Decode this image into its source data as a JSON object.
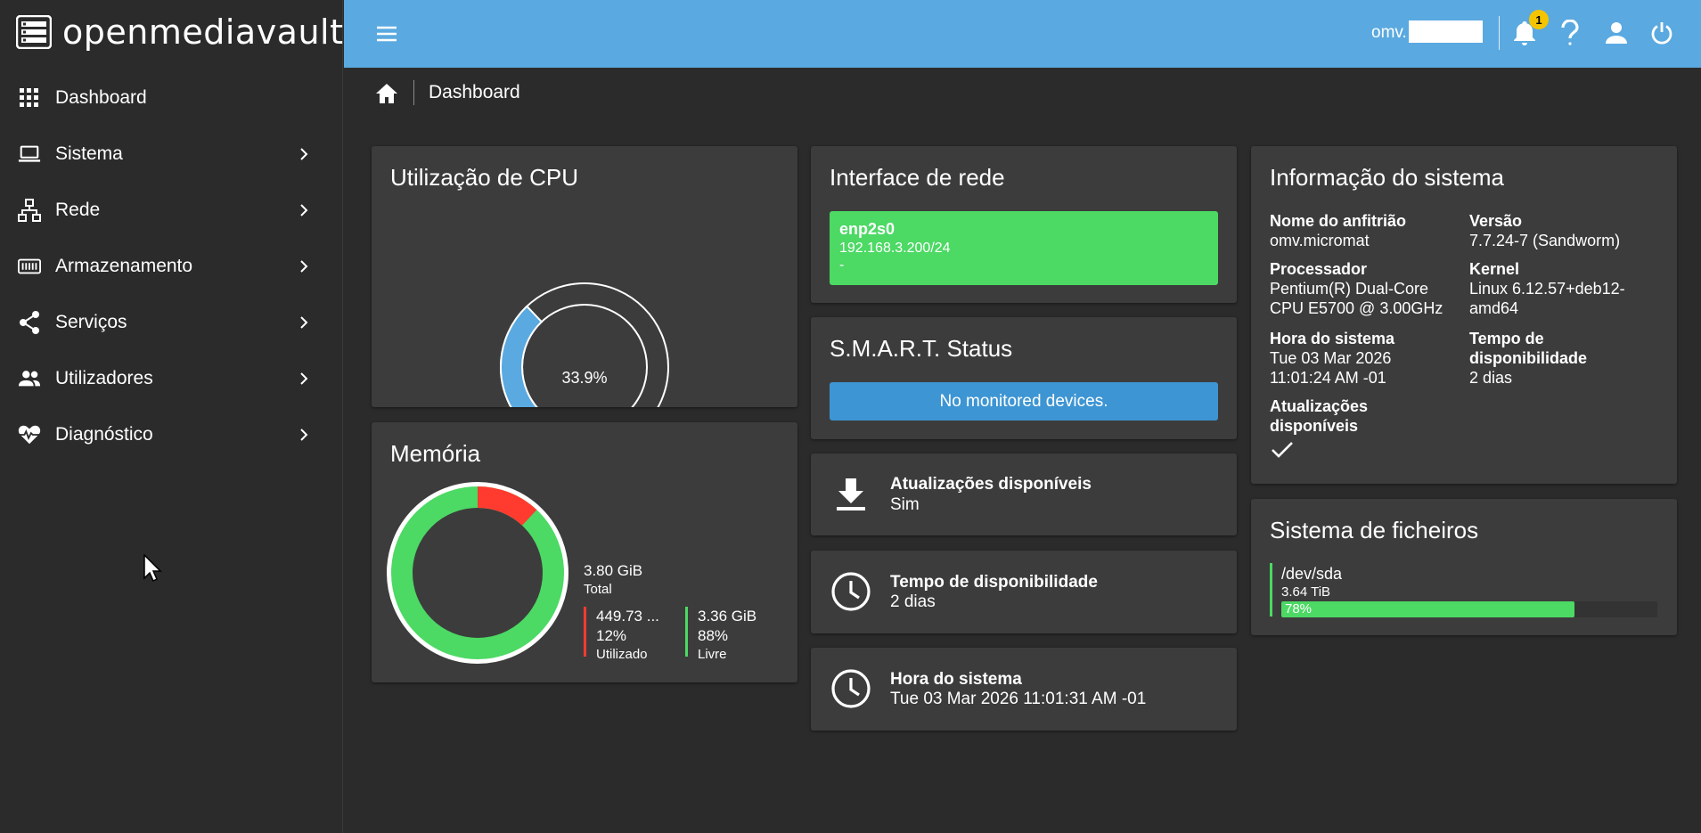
{
  "brand": {
    "name": "openmediavault"
  },
  "sidebar": {
    "items": [
      {
        "label": "Dashboard",
        "icon": "grid-icon",
        "has_children": false
      },
      {
        "label": "Sistema",
        "icon": "laptop-icon",
        "has_children": true
      },
      {
        "label": "Rede",
        "icon": "network-icon",
        "has_children": true
      },
      {
        "label": "Armazenamento",
        "icon": "storage-icon",
        "has_children": true
      },
      {
        "label": "Serviços",
        "icon": "share-icon",
        "has_children": true
      },
      {
        "label": "Utilizadores",
        "icon": "users-icon",
        "has_children": true
      },
      {
        "label": "Diagnóstico",
        "icon": "heartbeat-icon",
        "has_children": true
      }
    ]
  },
  "topbar": {
    "host_prefix": "omv.",
    "notification_count": "1",
    "icons": [
      "menu-icon",
      "bell-icon",
      "help-icon",
      "user-icon",
      "power-icon"
    ],
    "accent_color": "#5aa9e0"
  },
  "breadcrumb": {
    "current": "Dashboard"
  },
  "cpu": {
    "title": "Utilização de CPU",
    "value_label": "33.9%",
    "value": 33.9,
    "fill_color": "#5aa9e0"
  },
  "memory": {
    "title": "Memória",
    "total_value": "3.80 GiB",
    "total_label": "Total",
    "used_value": "449.73 ...",
    "used_pct": "12%",
    "used_label": "Utilizado",
    "free_value": "3.36 GiB",
    "free_pct": "88%",
    "free_label": "Livre",
    "used_fraction": 0.12,
    "used_color": "#ff3b30",
    "free_color": "#4cd964"
  },
  "network": {
    "title": "Interface de rede",
    "interface": "enp2s0",
    "address": "192.168.3.200/24",
    "extra": "-"
  },
  "smart": {
    "title": "S.M.A.R.T. Status",
    "message": "No monitored devices."
  },
  "updates_widget": {
    "title": "Atualizações disponíveis",
    "value": "Sim",
    "icon": "download-icon"
  },
  "uptime_widget": {
    "title": "Tempo de disponibilidade",
    "value": "2 dias",
    "icon": "clock-icon"
  },
  "time_widget": {
    "title": "Hora do sistema",
    "value": "Tue 03 Mar 2026 11:01:31 AM -01",
    "icon": "clock-icon"
  },
  "sysinfo": {
    "title": "Informação do sistema",
    "hostname_label": "Nome do anfitrião",
    "hostname_value": "omv.micromat",
    "version_label": "Versão",
    "version_value": "7.7.24-7 (Sandworm)",
    "processor_label": "Processador",
    "processor_value_1": "Pentium(R) Dual-Core",
    "processor_value_2": "CPU E5700 @ 3.00GHz",
    "kernel_label": "Kernel",
    "kernel_value_1": "Linux 6.12.57+deb12-",
    "kernel_value_2": "amd64",
    "time_label": "Hora do sistema",
    "time_value_1": "Tue 03 Mar 2026",
    "time_value_2": "11:01:24 AM -01",
    "uptime_label_1": "Tempo de",
    "uptime_label_2": "disponibilidade",
    "uptime_value": "2 dias",
    "updates_label_1": "Atualizações",
    "updates_label_2": "disponíveis",
    "updates_icon": "check-icon"
  },
  "filesystem": {
    "title": "Sistema de ficheiros",
    "device": "/dev/sda",
    "size": "3.64 TiB",
    "usage_label": "78%",
    "usage_fraction": 0.78
  }
}
